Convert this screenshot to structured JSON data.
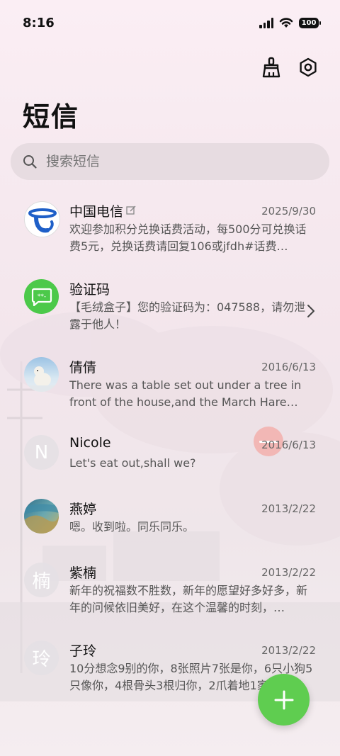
{
  "status": {
    "time": "8:16",
    "battery": "100"
  },
  "header": {
    "title": "短信"
  },
  "search": {
    "placeholder": "搜索短信"
  },
  "conversations": [
    {
      "name": "中国电信",
      "date": "2025/9/30",
      "preview": "欢迎参加积分兑换话费活动，每500分可兑换话费5元，兑换话费请回复106或jfdh#话费…",
      "avatar_icon": "china-telecom-logo",
      "has_edit_icon": true
    },
    {
      "name": "验证码",
      "date": "",
      "preview": "【毛绒盒子】您的验证码为：047588，请勿泄露于他人！",
      "avatar_icon": "message-bubble-icon",
      "avatar_color": "#4cc94a"
    },
    {
      "name": "倩倩",
      "date": "2016/6/13",
      "preview": "There was a table set out under a tree in front of the house,and the March Hare an…",
      "avatar_icon": "polar-bear-photo"
    },
    {
      "name": "Nicole",
      "date": "2016/6/13",
      "preview": "Let's eat out,shall we?",
      "avatar_letter": "N"
    },
    {
      "name": "燕婷",
      "date": "2013/2/22",
      "preview": "嗯。收到啦。同乐同乐。",
      "avatar_icon": "landscape-photo"
    },
    {
      "name": "紫楠",
      "date": "2013/2/22",
      "preview": "新年的祝福数不胜数，新年的愿望好多好多，新年的问候依旧美好，在这个温馨的时刻，…",
      "avatar_letter": "楠"
    },
    {
      "name": "子玲",
      "date": "2013/2/22",
      "preview": "10分想念9别的你，8张照片7张是你，6只小狗5只像你，4根骨头3根归你，2爪着地1家…",
      "avatar_letter": "玲"
    }
  ],
  "colors": {
    "fab": "#5fcd50",
    "telecom_blue": "#1e5fc8"
  }
}
